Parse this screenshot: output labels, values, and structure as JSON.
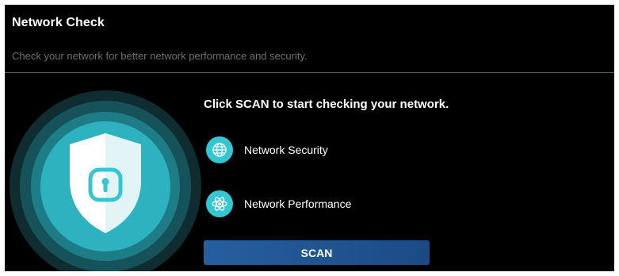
{
  "header": {
    "title": "Network Check",
    "subtitle": "Check your network for better network performance and security."
  },
  "main": {
    "prompt": "Click SCAN to start checking your network.",
    "features": [
      {
        "label": "Network Security",
        "icon": "globe-icon"
      },
      {
        "label": "Network Performance",
        "icon": "atom-icon"
      }
    ],
    "scan_button_label": "SCAN"
  },
  "illustration": {
    "icon": "shield-lock-icon"
  },
  "colors": {
    "background": "#000000",
    "accent": "#32c7d2",
    "button": "#255f9f",
    "subtitle_text": "#6f6f6f"
  }
}
